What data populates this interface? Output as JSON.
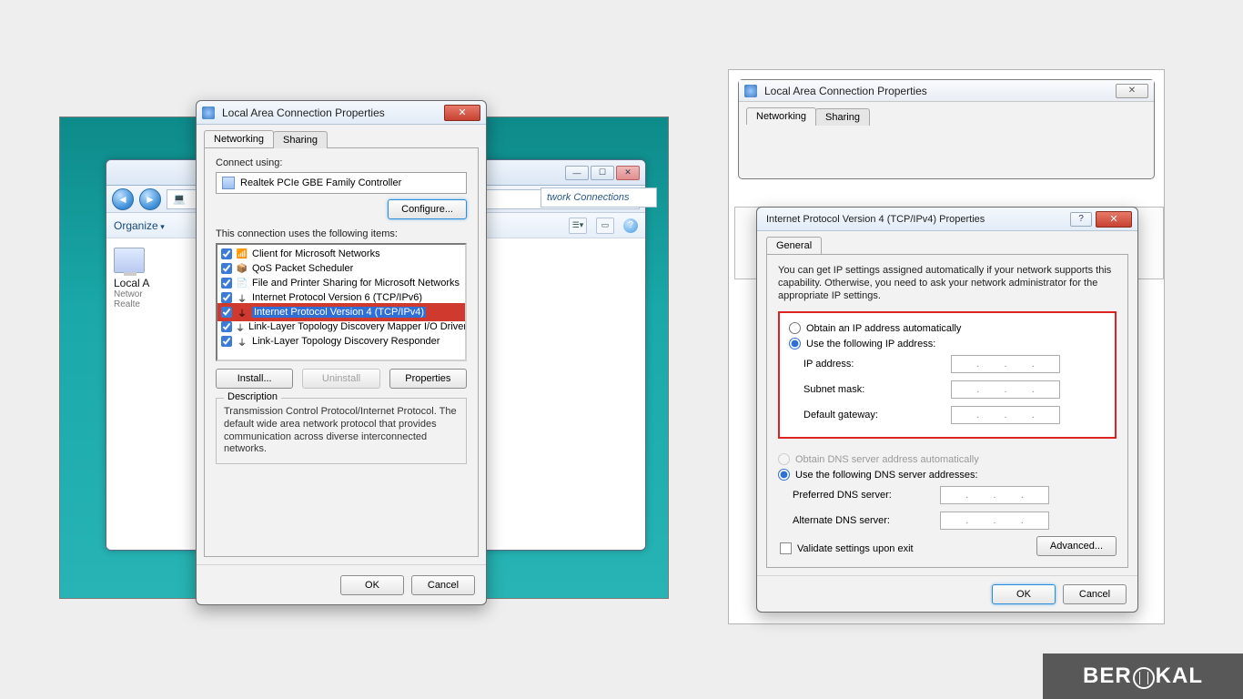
{
  "brand": "BEROKAL",
  "left": {
    "explorer": {
      "breadcrumb_text": "twork Connections",
      "organize_label": "Organize",
      "conn": {
        "title": "Local A",
        "sub1": "Networ",
        "sub2": "Realte"
      }
    },
    "lac": {
      "title": "Local Area Connection Properties",
      "tabs": {
        "networking": "Networking",
        "sharing": "Sharing"
      },
      "connect_using_label": "Connect using:",
      "adapter": "Realtek PCIe GBE Family Controller",
      "configure_btn": "Configure...",
      "uses_label": "This connection uses the following items:",
      "items": [
        {
          "checked": true,
          "label": "Client for Microsoft Networks",
          "icon": "📶"
        },
        {
          "checked": true,
          "label": "QoS Packet Scheduler",
          "icon": "📦"
        },
        {
          "checked": true,
          "label": "File and Printer Sharing for Microsoft Networks",
          "icon": "📄"
        },
        {
          "checked": true,
          "label": "Internet Protocol Version 6 (TCP/IPv6)",
          "icon": "⏚"
        },
        {
          "checked": true,
          "label": "Internet Protocol Version 4 (TCP/IPv4)",
          "icon": "⏚",
          "selected": true
        },
        {
          "checked": true,
          "label": "Link-Layer Topology Discovery Mapper I/O Driver",
          "icon": "⏚"
        },
        {
          "checked": true,
          "label": "Link-Layer Topology Discovery Responder",
          "icon": "⏚"
        }
      ],
      "install_btn": "Install...",
      "uninstall_btn": "Uninstall",
      "properties_btn": "Properties",
      "desc_title": "Description",
      "desc_text": "Transmission Control Protocol/Internet Protocol. The default wide area network protocol that provides communication across diverse interconnected networks.",
      "ok": "OK",
      "cancel": "Cancel"
    }
  },
  "right": {
    "lac2": {
      "title": "Local Area Connection Properties",
      "tabs": {
        "networking": "Networking",
        "sharing": "Sharing"
      }
    },
    "tcpip": {
      "title": "Internet Protocol Version 4 (TCP/IPv4) Properties",
      "tab": "General",
      "intro": "You can get IP settings assigned automatically if your network supports this capability. Otherwise, you need to ask your network administrator for the appropriate IP settings.",
      "radio_auto_ip": "Obtain an IP address automatically",
      "radio_manual_ip": "Use the following IP address:",
      "ip_label": "IP address:",
      "subnet_label": "Subnet mask:",
      "gateway_label": "Default gateway:",
      "radio_auto_dns": "Obtain DNS server address automatically",
      "radio_manual_dns": "Use the following DNS server addresses:",
      "pref_dns_label": "Preferred DNS server:",
      "alt_dns_label": "Alternate DNS server:",
      "validate_label": "Validate settings upon exit",
      "advanced_btn": "Advanced...",
      "ok": "OK",
      "cancel": "Cancel"
    }
  }
}
